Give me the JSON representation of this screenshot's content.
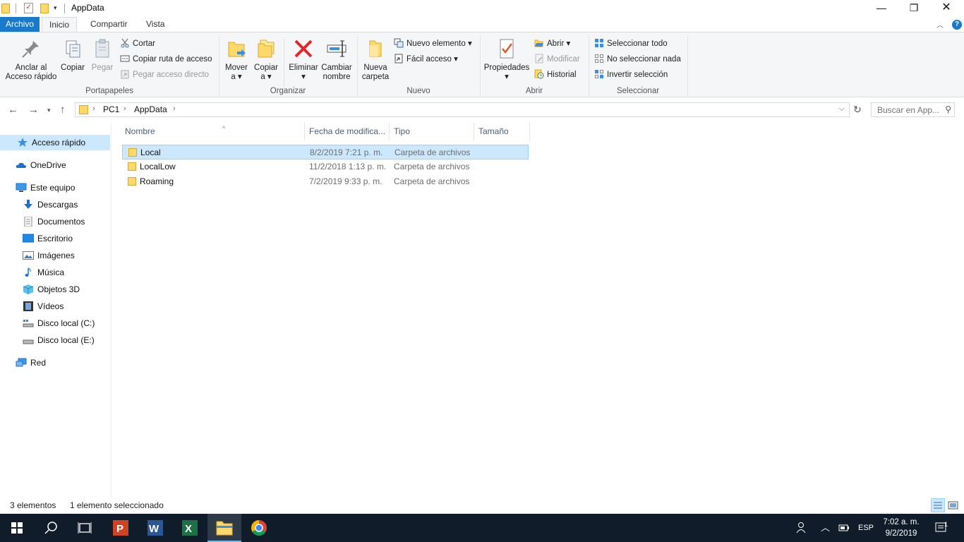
{
  "window": {
    "title": "AppData",
    "minimize_glyph": "—",
    "maximize_glyph": "❐",
    "close_glyph": "✕"
  },
  "ribbon_tabs": [
    {
      "label": "Archivo"
    },
    {
      "label": "Inicio"
    },
    {
      "label": "Compartir"
    },
    {
      "label": "Vista"
    }
  ],
  "ribbon": {
    "portapapeles": {
      "group_label": "Portapapeles",
      "pin_label_1": "Anclar al",
      "pin_label_2": "Acceso rápido",
      "copy_label": "Copiar",
      "paste_label": "Pegar",
      "cut_label": "Cortar",
      "copy_path_label": "Copiar ruta de acceso",
      "paste_shortcut_label": "Pegar acceso directo"
    },
    "organizar": {
      "group_label": "Organizar",
      "move_label_1": "Mover",
      "move_label_2": "a",
      "copyto_label_1": "Copiar",
      "copyto_label_2": "a",
      "delete_label": "Eliminar",
      "rename_label_1": "Cambiar",
      "rename_label_2": "nombre"
    },
    "nuevo": {
      "group_label": "Nuevo",
      "new_folder_label_1": "Nueva",
      "new_folder_label_2": "carpeta",
      "new_item_label": "Nuevo elemento",
      "easy_access_label": "Fácil acceso"
    },
    "abrir": {
      "group_label": "Abrir",
      "properties_label": "Propiedades",
      "open_label": "Abrir",
      "edit_label": "Modificar",
      "history_label": "Historial"
    },
    "seleccionar": {
      "group_label": "Seleccionar",
      "select_all_label": "Seleccionar todo",
      "select_none_label": "No seleccionar nada",
      "invert_label": "Invertir selección"
    }
  },
  "address": {
    "crumbs": [
      "PC1",
      "AppData"
    ],
    "search_placeholder": "Buscar en App..."
  },
  "nav_pane": [
    {
      "label": "Acceso rápido",
      "icon": "star-icon"
    },
    {
      "label": "OneDrive",
      "icon": "cloud-icon"
    },
    {
      "label": "Este equipo",
      "icon": "computer-icon"
    },
    {
      "label": "Descargas",
      "icon": "download-icon"
    },
    {
      "label": "Documentos",
      "icon": "document-icon"
    },
    {
      "label": "Escritorio",
      "icon": "desktop-icon"
    },
    {
      "label": "Imágenes",
      "icon": "image-icon"
    },
    {
      "label": "Música",
      "icon": "music-icon"
    },
    {
      "label": "Objetos 3D",
      "icon": "cube-icon"
    },
    {
      "label": "Vídeos",
      "icon": "video-icon"
    },
    {
      "label": "Disco local (C:)",
      "icon": "drive-icon"
    },
    {
      "label": "Disco local (E:)",
      "icon": "drive-icon"
    },
    {
      "label": "Red",
      "icon": "network-icon"
    }
  ],
  "columns": [
    "Nombre",
    "Fecha de modifica...",
    "Tipo",
    "Tamaño"
  ],
  "files": [
    {
      "name": "Local",
      "date": "8/2/2019 7:21 p. m.",
      "type": "Carpeta de archivos",
      "selected": true
    },
    {
      "name": "LocalLow",
      "date": "11/2/2018 1:13 p. m.",
      "type": "Carpeta de archivos",
      "selected": false
    },
    {
      "name": "Roaming",
      "date": "7/2/2019 9:33 p. m.",
      "type": "Carpeta de archivos",
      "selected": false
    }
  ],
  "status": {
    "count": "3 elementos",
    "selection": "1 elemento seleccionado"
  },
  "taskbar": {
    "apps": [
      "start-icon",
      "search-icon",
      "task-view-icon",
      "powerpoint-icon",
      "word-icon",
      "excel-icon",
      "file-explorer-icon",
      "chrome-icon"
    ],
    "language": "ESP",
    "time": "7:02 a. m.",
    "date": "9/2/2019",
    "notification_count": "1"
  },
  "colors": {
    "accent": "#1979ca",
    "selection": "#cce8ff",
    "selection_border": "#99d1ff",
    "folder": "#ffd86b",
    "taskbar": "#101c2a"
  }
}
